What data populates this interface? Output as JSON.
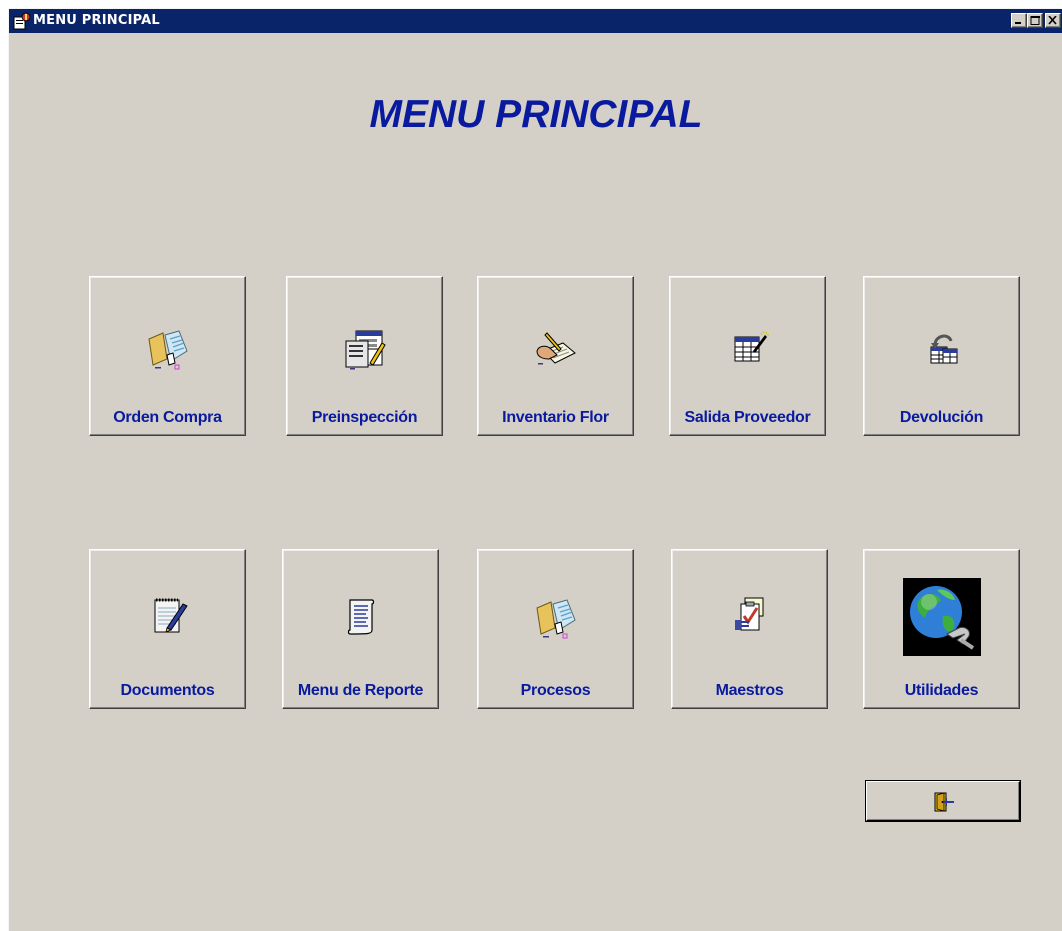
{
  "window": {
    "title": "MENU PRINCIPAL",
    "title_bar_color": "#0a246a"
  },
  "heading": "MENU PRINCIPAL",
  "accent_color": "#0a1a9e",
  "menu": {
    "row1": [
      {
        "label": "Orden Compra",
        "icon": "folder-document-icon"
      },
      {
        "label": "Preinspección",
        "icon": "forms-edit-icon"
      },
      {
        "label": "Inventario Flor",
        "icon": "hand-writing-notepad-icon"
      },
      {
        "label": "Salida Proveedor",
        "icon": "table-magic-wand-icon"
      },
      {
        "label": "Devolución",
        "icon": "return-tables-icon"
      }
    ],
    "row2": [
      {
        "label": "Documentos",
        "icon": "notepad-pen-icon"
      },
      {
        "label": "Menu de Reporte",
        "icon": "report-scroll-icon"
      },
      {
        "label": "Procesos",
        "icon": "folder-document-icon"
      },
      {
        "label": "Maestros",
        "icon": "checklist-icon"
      },
      {
        "label": "Utilidades",
        "icon": "globe-network-icon"
      }
    ]
  },
  "exit_button": {
    "icon": "exit-door-icon"
  }
}
